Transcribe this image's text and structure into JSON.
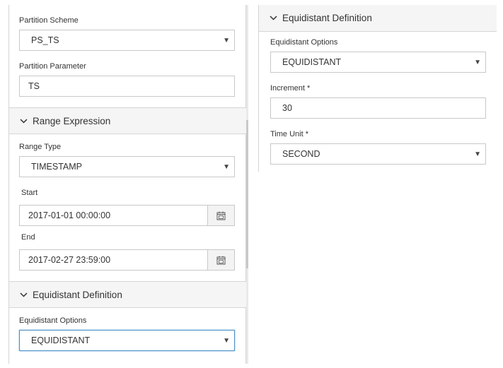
{
  "left": {
    "partition_scheme": {
      "label": "Partition Scheme",
      "value": "PS_TS"
    },
    "partition_parameter": {
      "label": "Partition Parameter",
      "value": "TS"
    },
    "range_expression": {
      "title": "Range Expression",
      "range_type": {
        "label": "Range Type",
        "value": "TIMESTAMP"
      },
      "start": {
        "label": "Start",
        "value": "2017-01-01 00:00:00"
      },
      "end": {
        "label": "End",
        "value": "2017-02-27 23:59:00"
      }
    },
    "equidistant_definition": {
      "title": "Equidistant Definition",
      "options": {
        "label": "Equidistant Options",
        "value": "EQUIDISTANT"
      }
    }
  },
  "right": {
    "equidistant_definition": {
      "title": "Equidistant Definition",
      "options": {
        "label": "Equidistant Options",
        "value": "EQUIDISTANT"
      },
      "increment": {
        "label": "Increment *",
        "value": "30"
      },
      "time_unit": {
        "label": "Time Unit *",
        "value": "SECOND"
      }
    }
  },
  "icons": {
    "dropdown": "caret-down-icon",
    "calendar": "calendar-icon",
    "collapse": "chevron-down-icon"
  },
  "colors": {
    "border": "#c8c8c8",
    "focus_border": "#4a90c8",
    "section_background": "#f5f5f5"
  }
}
